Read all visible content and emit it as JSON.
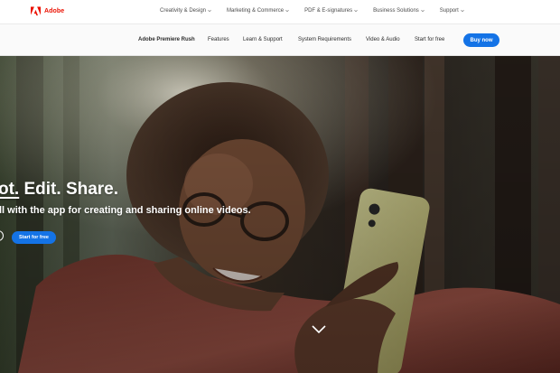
{
  "global_nav": {
    "brand": "Adobe",
    "menu": [
      {
        "label": "Creativity & Design",
        "icon": "chevron-down-icon"
      },
      {
        "label": "Marketing & Commerce",
        "icon": "chevron-down-icon"
      },
      {
        "label": "PDF & E-signatures",
        "icon": "chevron-down-icon"
      },
      {
        "label": "Business Solutions",
        "icon": "chevron-down-icon"
      },
      {
        "label": "Support",
        "icon": "chevron-down-icon"
      }
    ]
  },
  "local_nav": {
    "product_name": "Adobe Premiere Rush",
    "links": [
      "Features",
      "Learn & Support",
      "System Requirements",
      "Video & Audio",
      "Start for free"
    ],
    "buy_label": "Buy now"
  },
  "hero": {
    "title_first": "ot.",
    "title_rest": " Edit. Share.",
    "subtitle": "ll with the app for creating and sharing online videos.",
    "cta_label": "Start for free",
    "scroll_icon": "chevron-down-icon"
  },
  "colors": {
    "brand_red": "#eb1000",
    "accent_blue": "#1473e6"
  }
}
